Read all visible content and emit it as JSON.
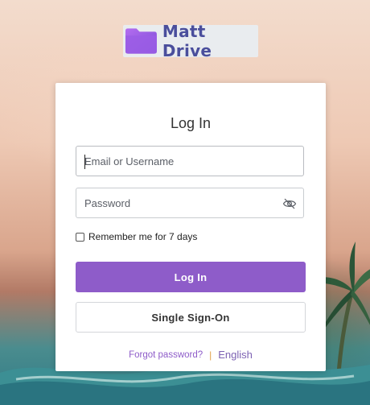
{
  "brand": {
    "name": "Matt Drive",
    "folder_color": "#9b5de5",
    "text_color": "#4a4e9c"
  },
  "login": {
    "title": "Log In",
    "email_placeholder": "Email or Username",
    "password_placeholder": "Password",
    "remember_label": "Remember me for 7 days",
    "remember_checked": false,
    "login_button": "Log In",
    "sso_button": "Single Sign-On",
    "forgot_link": "Forgot password?",
    "separator": "|",
    "language": "English",
    "accent_color": "#8e5cc9"
  },
  "icons": {
    "password_toggle": "eye-slash-icon",
    "logo": "folder-icon"
  }
}
